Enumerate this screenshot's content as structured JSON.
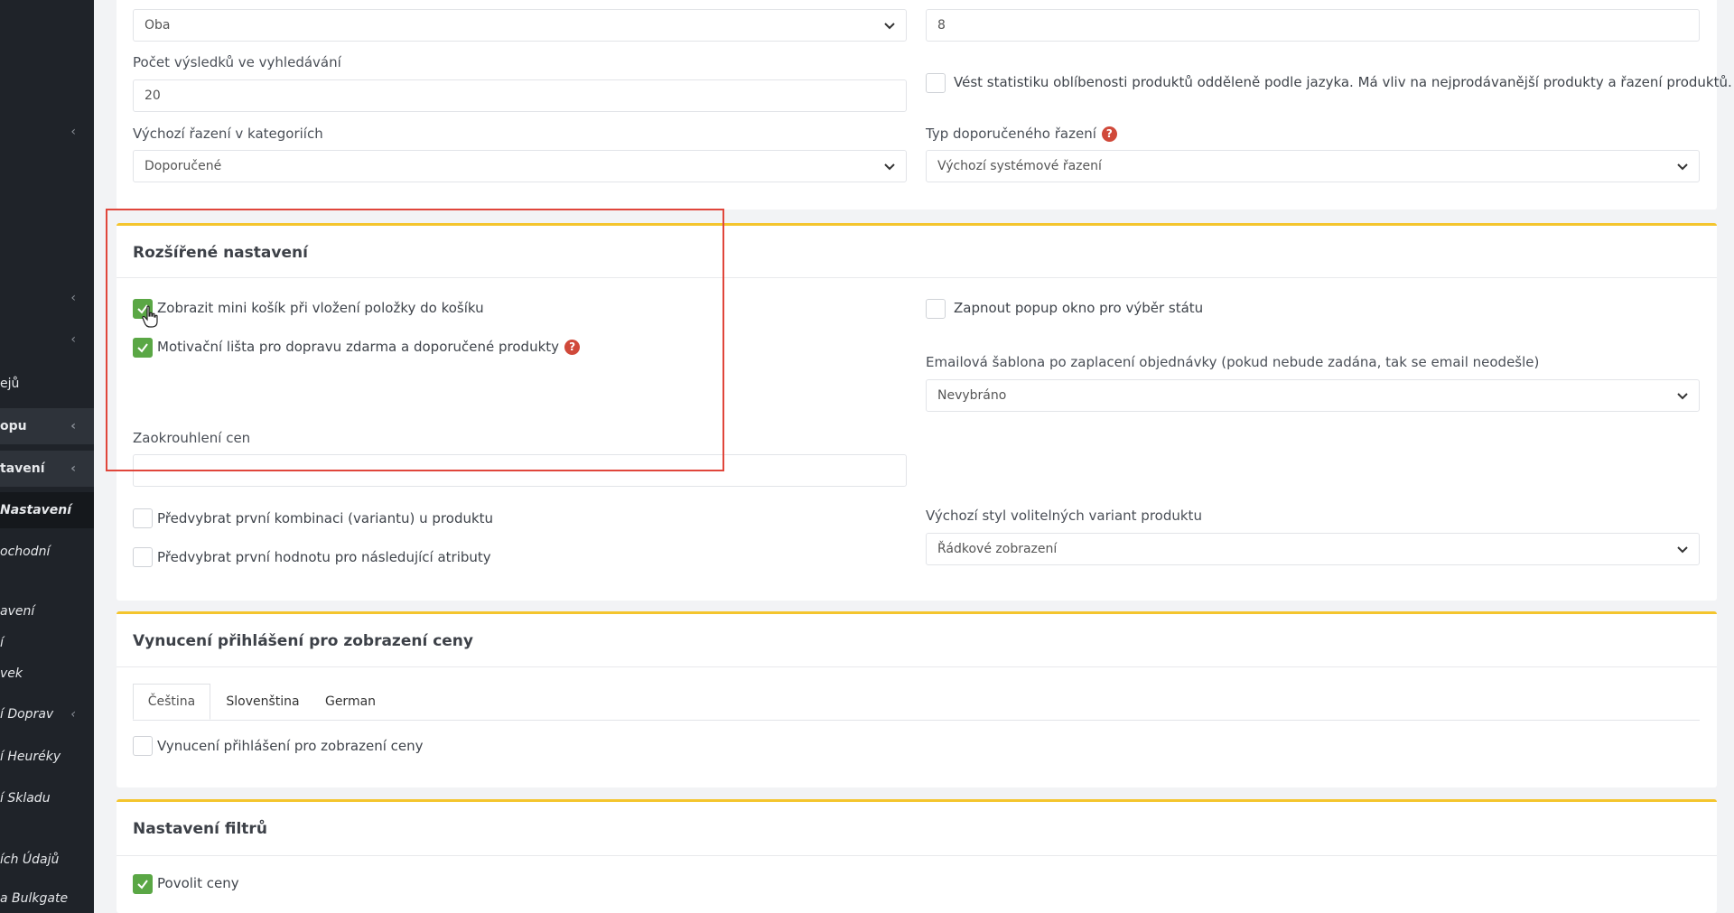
{
  "colors": {
    "accent": "#f4c52d",
    "check": "#5aa745",
    "help": "#d0493a",
    "highlight": "#e0463b",
    "sidebar": "#1f2329"
  },
  "sidebar": {
    "items": [
      {
        "label": "ejů"
      },
      {
        "label": "opu"
      },
      {
        "label": "tavení"
      },
      {
        "label": "Nastavení"
      },
      {
        "label": "ochodní"
      },
      {
        "label": "avení"
      },
      {
        "label": "í"
      },
      {
        "label": "vek"
      },
      {
        "label": "í Doprav"
      },
      {
        "label": "í Heuréky"
      },
      {
        "label": "í Skladu"
      },
      {
        "label": "ích Údajů"
      },
      {
        "label": "a Bulkgate"
      }
    ]
  },
  "top_section": {
    "select1_value": "Oba",
    "input_right_value": "8",
    "results_label": "Počet výsledků ve vyhledávání",
    "results_value": "20",
    "stats_checkbox_label": "Vést statistiku oblíbenosti produktů odděleně podle jazyka. Má vliv na nejprodávanější produkty a řazení produktů.",
    "default_sort_label": "Výchozí řazení v kategoriích",
    "default_sort_value": "Doporučené",
    "recommended_sort_label": "Typ doporučeného řazení",
    "recommended_sort_value": "Výchozí systémové řazení"
  },
  "advanced": {
    "title": "Rozšířené nastavení",
    "mini_cart_label": "Zobrazit mini košík při vložení položky do košíku",
    "mini_cart_checked": true,
    "motivation_label": "Motivační lišta pro dopravu zdarma a doporučené produkty",
    "motivation_checked": true,
    "popup_label": "Zapnout popup okno pro výběr státu",
    "email_template_label": "Emailová šablona po zaplacení objednávky (pokud nebude zadána, tak se email neodešle)",
    "email_template_value": "Nevybráno",
    "rounding_label": "Zaokrouhlení cen",
    "rounding_value": "",
    "preselect_combo_label": "Předvybrat první kombinaci (variantu) u produktu",
    "preselect_value_label": "Předvybrat první hodnotu pro následující atributy",
    "variant_style_label": "Výchozí styl volitelných variant produktu",
    "variant_style_value": "Řádkové zobrazení"
  },
  "login_section": {
    "title": "Vynucení přihlášení pro zobrazení ceny",
    "tabs": [
      "Čeština",
      "Slovenština",
      "German"
    ],
    "checkbox_label": "Vynucení přihlášení pro zobrazení ceny"
  },
  "filters_section": {
    "title": "Nastavení filtrů",
    "prices_label": "Povolit ceny",
    "prices_checked": true
  }
}
